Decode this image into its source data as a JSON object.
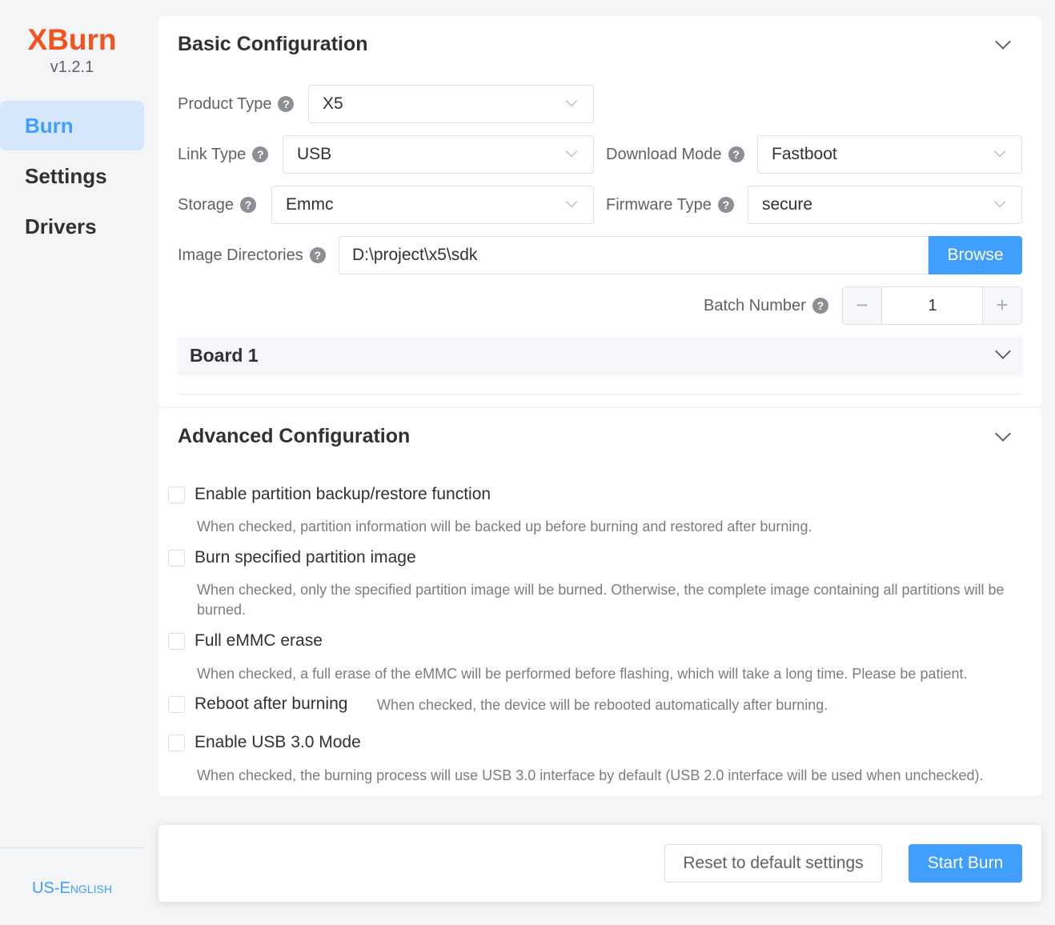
{
  "app": {
    "name": "XBurn",
    "version": "v1.2.1"
  },
  "nav": [
    {
      "label": "Burn",
      "active": true
    },
    {
      "label": "Settings",
      "active": false
    },
    {
      "label": "Drivers",
      "active": false
    }
  ],
  "language": "US-English",
  "basic": {
    "title": "Basic Configuration",
    "product_type": {
      "label": "Product Type",
      "value": "X5"
    },
    "link_type": {
      "label": "Link Type",
      "value": "USB"
    },
    "download_mode": {
      "label": "Download Mode",
      "value": "Fastboot"
    },
    "storage": {
      "label": "Storage",
      "value": "Emmc"
    },
    "firmware_type": {
      "label": "Firmware Type",
      "value": "secure"
    },
    "image_dirs": {
      "label": "Image Directories",
      "value": "D:\\project\\x5\\sdk",
      "browse": "Browse"
    },
    "batch": {
      "label": "Batch Number",
      "value": "1",
      "minus": "−",
      "plus": "+"
    },
    "board": {
      "title": "Board 1"
    }
  },
  "advanced": {
    "title": "Advanced Configuration",
    "options": [
      {
        "label": "Enable partition backup/restore function",
        "desc": "When checked, partition information will be backed up before burning and restored after burning.",
        "checked": false
      },
      {
        "label": "Burn specified partition image",
        "desc": "When checked, only the specified partition image will be burned. Otherwise, the complete image containing all partitions will be burned.",
        "checked": false
      },
      {
        "label": "Full eMMC erase",
        "desc": "When checked, a full erase of the eMMC will be performed before flashing, which will take a long time. Please be patient.",
        "checked": false
      },
      {
        "label": "Reboot after burning",
        "desc": "When checked, the device will be rebooted automatically after burning.",
        "checked": false
      },
      {
        "label": "Enable USB 3.0 Mode",
        "desc": "When checked, the burning process will use USB 3.0 interface by default (USB 2.0 interface will be used when unchecked).",
        "checked": false
      }
    ]
  },
  "footer": {
    "reset": "Reset to default settings",
    "start": "Start Burn"
  },
  "colors": {
    "brand": "#f2531f",
    "primary": "#409eff",
    "nav_active_bg": "#d6e7fb"
  },
  "icons": {
    "help": "question-circle-icon",
    "expand": "chevron-down-icon"
  }
}
